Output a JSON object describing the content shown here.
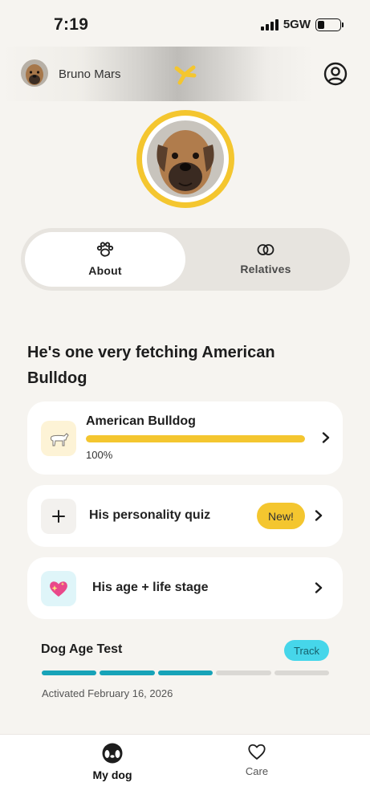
{
  "status_bar": {
    "time": "7:19",
    "network": "5GW",
    "battery_percent": 25
  },
  "header": {
    "user_name": "Bruno Mars"
  },
  "segments": [
    {
      "label": "About",
      "icon": "paw-icon",
      "selected": true
    },
    {
      "label": "Relatives",
      "icon": "rings-icon",
      "selected": false
    }
  ],
  "headline": "He's one very fetching American Bulldog",
  "breed_card": {
    "name": "American Bulldog",
    "percent_label": "100%",
    "percent": 100
  },
  "quiz_card": {
    "title": "His personality quiz",
    "badge": "New!"
  },
  "age_card": {
    "title": "His age + life stage"
  },
  "age_test": {
    "title": "Dog Age Test",
    "badge": "Track",
    "steps_done": 3,
    "steps_total": 5,
    "activated": "Activated February 16, 2026"
  },
  "tabbar": {
    "tabs": [
      {
        "label": "My dog",
        "selected": true
      },
      {
        "label": "Care",
        "selected": false
      }
    ]
  },
  "colors": {
    "accent_yellow": "#f4c62f",
    "teal": "#17a3b8",
    "track_badge": "#46d6ea",
    "background": "#f6f4f0"
  }
}
